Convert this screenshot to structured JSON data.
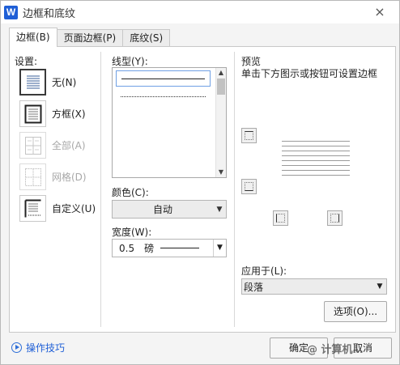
{
  "window": {
    "title": "边框和底纹",
    "app_icon": "W",
    "close_icon": "×"
  },
  "tabs": [
    {
      "label": "边框(B)",
      "active": true
    },
    {
      "label": "页面边框(P)",
      "active": false
    },
    {
      "label": "底纹(S)",
      "active": false
    }
  ],
  "settings": {
    "label": "设置:",
    "items": [
      {
        "label": "无(N)",
        "icon": "none-border-icon",
        "state": "selected"
      },
      {
        "label": "方框(X)",
        "icon": "box-border-icon",
        "state": "normal"
      },
      {
        "label": "全部(A)",
        "icon": "all-border-icon",
        "state": "disabled"
      },
      {
        "label": "网格(D)",
        "icon": "grid-border-icon",
        "state": "disabled"
      },
      {
        "label": "自定义(U)",
        "icon": "custom-border-icon",
        "state": "normal"
      }
    ]
  },
  "line_style": {
    "label": "线型(Y):",
    "options": [
      "solid",
      "dotted-fine",
      "dashed-small",
      "dashed-medium",
      "dashed-long",
      "dash-dot"
    ]
  },
  "color": {
    "label": "颜色(C):",
    "value": "自动"
  },
  "width": {
    "label": "宽度(W):",
    "value": "0.5",
    "unit": "磅"
  },
  "preview": {
    "title": "预览",
    "hint": "单击下方图示或按钮可设置边框"
  },
  "apply_to": {
    "label": "应用于(L):",
    "value": "段落"
  },
  "buttons": {
    "options": "选项(O)...",
    "ok": "确定",
    "cancel": "取消"
  },
  "footer": {
    "tips_label": "操作技巧"
  },
  "watermark": "@ 计算机…",
  "colors": {
    "accent": "#1f5fd6",
    "border": "#a9a9a9"
  }
}
